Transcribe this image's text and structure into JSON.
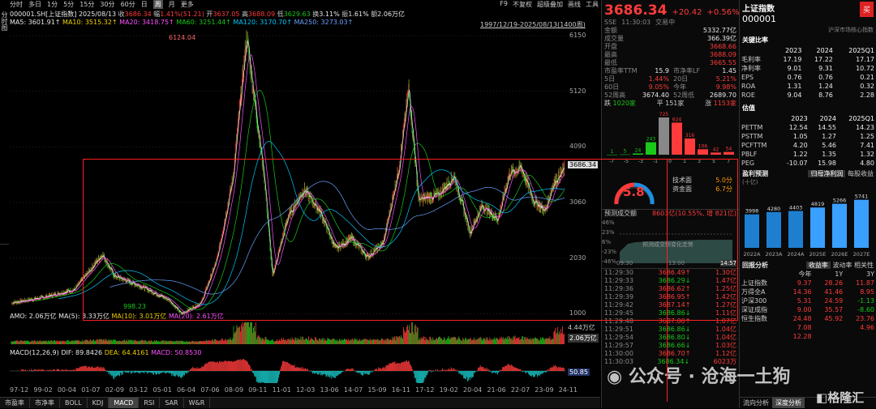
{
  "toolbar": {
    "items": [
      "分时",
      "多日",
      "1分",
      "5分",
      "15分",
      "30分",
      "60分",
      "日",
      "周",
      "月",
      "更多"
    ],
    "active": "周",
    "right": [
      "F9",
      "不复权",
      "超级叠加",
      "画线",
      "工具"
    ]
  },
  "leftbar": [
    "分时图",
    "K线图",
    "TICK",
    "成交明细",
    "深度资料",
    "超级复盘"
  ],
  "info": {
    "code": "000001.SH[上证指数]",
    "date": "2025/08/13",
    "close_label": "收",
    "close": "3686.34",
    "chg_label": "幅",
    "chg": "1.41%(51.21)",
    "open_label": "开",
    "open": "3637.05",
    "high_label": "高",
    "high": "3688.09",
    "low_label": "低",
    "low": "3629.63",
    "turn_label": "换",
    "turn": "3.11%",
    "amp_label": "振",
    "amp": "1.61%",
    "amt_label": "额",
    "amt": "2.06万亿"
  },
  "ma": {
    "ma5": "MA5: 3601.91↑",
    "ma10": "MA10: 3515.32↑",
    "ma20": "MA20: 3418.75↑",
    "ma60": "MA60: 3251.44↑",
    "ma120": "MA120: 3170.70↑",
    "ma250": "MA250: 3273.03↑"
  },
  "range_label": "1997/12/19-2025/08/13(1400周)",
  "price_labels": {
    "peak": "6124.04",
    "trough": "998.23",
    "current": "3686.34"
  },
  "yaxis": [
    "6150",
    "5120",
    "4090",
    "3060",
    "2030",
    "1000"
  ],
  "amo": {
    "amo": "AMO: 2.06万亿",
    "ma5": "MA(5): 3.33万亿",
    "ma10": "MA(10): 3.01万亿",
    "ma20": "MA(20): 2.61万亿"
  },
  "vol_axis": [
    "4.44万亿",
    "2.06万亿"
  ],
  "macd": {
    "title": "MACD(12,26,9)",
    "dif": "DIF: 89.8426",
    "dea": "DEA: 64.4161",
    "macd": "MACD: 50.8530",
    "axis": "50.85"
  },
  "dates": [
    "97-12",
    "99-02",
    "00-04",
    "01-07",
    "02-09",
    "03-12",
    "05-01",
    "06-04",
    "07-06",
    "08-09",
    "09-11",
    "11-01",
    "12-03",
    "13-06",
    "14-07",
    "15-09",
    "16-11",
    "17-12",
    "19-02",
    "20-04",
    "21-06",
    "22-07",
    "23-09",
    "24-11"
  ],
  "bottom_tabs": [
    "市盈率",
    "市净率",
    "BOLL",
    "KDJ",
    "MACD",
    "RSI",
    "SAR",
    "W&R"
  ],
  "bottom_active": "MACD",
  "quote": {
    "price": "3686.34",
    "chg": "+20.42",
    "pct": "+0.56%",
    "exchange": "SSE",
    "time": "11:30:03",
    "status": "交易中"
  },
  "stats": [
    {
      "k": "金额",
      "v": "5332.77亿"
    },
    {
      "k": "成交量",
      "v": "366.39亿"
    },
    {
      "k": "开盘",
      "v": "3668.66"
    },
    {
      "k": "最高",
      "v": "3688.09"
    },
    {
      "k": "最低",
      "v": "3665.55"
    }
  ],
  "stats2": [
    [
      "市盈率TTM",
      "15.9",
      "市净率LF",
      "1.45"
    ],
    [
      "5日",
      "1.44%",
      "20日",
      "5.21%"
    ],
    [
      "60日",
      "9.05%",
      "今年",
      "9.98%"
    ],
    [
      "52周高",
      "3674.40",
      "52周低",
      "2689.70"
    ]
  ],
  "breadth": {
    "down_label": "跌",
    "down": "1020家",
    "flat_label": "平",
    "flat": "151家",
    "up_label": "涨",
    "up": "1153家"
  },
  "dist": {
    "labels": [
      "-7",
      "-5",
      "-3",
      "-1",
      "0",
      "1",
      "3",
      "5",
      "7"
    ],
    "values": [
      "1",
      "5",
      "24",
      "243",
      "725",
      "624",
      "316",
      "106",
      "42",
      "54"
    ]
  },
  "gauge": {
    "value": "5.8",
    "tech_label": "技术面",
    "tech": "5.0分",
    "fund_label": "资金面",
    "fund": "6.7分"
  },
  "forecast": {
    "title": "预测成交额",
    "value": "8603亿(10.55%, 增 821亿)",
    "ylabels": [
      "46%",
      "23%",
      "6%",
      "-23%",
      "-46%"
    ],
    "times": [
      "09:30",
      "13:00",
      "14:57"
    ],
    "caption": "预测成交额变化走势"
  },
  "ticks": [
    [
      "11:29:30",
      "3686.49↑",
      "1.30亿"
    ],
    [
      "11:29:33",
      "3686.29↓",
      "1.47亿"
    ],
    [
      "11:29:36",
      "3686.62↑",
      "1.25亿"
    ],
    [
      "11:29:39",
      "3686.95↑",
      "1.42亿"
    ],
    [
      "11:29:42",
      "3687.14↑",
      "1.27亿"
    ],
    [
      "11:29:45",
      "3686.86↓",
      "1.11亿"
    ],
    [
      "11:29:48",
      "3687.00↑",
      "1.07亿"
    ],
    [
      "11:29:51",
      "3686.86↓",
      "1.04亿"
    ],
    [
      "11:29:54",
      "3686.80↓",
      "1.04亿"
    ],
    [
      "11:29:57",
      "3686.66↓",
      "1.03亿"
    ],
    [
      "11:30:00",
      "3686.70↑",
      "1.12亿"
    ],
    [
      "11:30:03",
      "3686.34↓",
      "6023万"
    ]
  ],
  "header2": {
    "name": "上证指数",
    "code": "000001",
    "buy": "买",
    "sub": "沪深市场核心指数"
  },
  "fund": {
    "title": "关键比率",
    "years": [
      "2023",
      "2024",
      "2025Q1"
    ],
    "rows": [
      [
        "毛利率",
        "17.19",
        "17.22",
        "17.17"
      ],
      [
        "净利率",
        "9.01",
        "9.31",
        "10.72"
      ],
      [
        "EPS",
        "0.76",
        "0.76",
        "0.21"
      ],
      [
        "ROA",
        "1.31",
        "1.24",
        "0.32"
      ],
      [
        "ROE",
        "9.04",
        "8.76",
        "2.28"
      ]
    ]
  },
  "valuation": {
    "title": "估值",
    "years": [
      "2023",
      "2024",
      "2025Q1"
    ],
    "rows": [
      [
        "PETTM",
        "12.54",
        "14.55",
        "14.23"
      ],
      [
        "PSTTM",
        "1.05",
        "1.27",
        "1.25"
      ],
      [
        "PCFTTM",
        "4.20",
        "5.46",
        "7.41"
      ],
      [
        "PBLF",
        "1.22",
        "1.35",
        "1.32"
      ],
      [
        "PEG",
        "-10.07",
        "15.98",
        "4.80"
      ]
    ]
  },
  "profit": {
    "title": "盈利预测",
    "unit": "(十亿)",
    "tab1": "归母净利润",
    "tab2": "每股收益",
    "bars": [
      {
        "label": "2022A",
        "value": 3998
      },
      {
        "label": "2023A",
        "value": 4280
      },
      {
        "label": "2024A",
        "value": 4403
      },
      {
        "label": "2025E",
        "value": 4819
      },
      {
        "label": "2026E",
        "value": 5266
      },
      {
        "label": "2027E",
        "value": 5741
      }
    ]
  },
  "returns": {
    "title": "回报分析",
    "tabs": [
      "收益率",
      "波动率",
      "相关性"
    ],
    "cols": [
      "今年",
      "1Y",
      "3Y"
    ],
    "rows": [
      [
        "上证指数",
        "9.37",
        "28.26",
        "11.87"
      ],
      [
        "万得全A",
        "14.36",
        "41.46",
        "8.95"
      ],
      [
        "沪深300",
        "5.31",
        "24.59",
        "-1.13"
      ],
      [
        "深证成指",
        "9.00",
        "35.57",
        "-8.60"
      ],
      [
        "恒生指数",
        "24.48",
        "45.92",
        "23.76"
      ],
      [
        "",
        "7.08",
        "",
        "4.96"
      ],
      [
        "",
        "12.28",
        "",
        ""
      ]
    ]
  },
  "foot2": {
    "tabs": [
      "流向分析",
      "深度分析"
    ]
  },
  "watermark": "公众号 · 沧海一土狗",
  "watermark2": "格隆汇"
}
